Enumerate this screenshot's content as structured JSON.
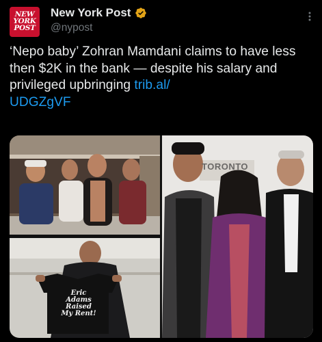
{
  "account": {
    "avatar_lines": [
      "NEW",
      "YORK",
      "POST"
    ],
    "display_name": "New York Post",
    "handle": "@nypost",
    "verified_color": "#e2a317"
  },
  "tweet": {
    "text": "‘Nepo baby’ Zohran Mamdani claims to have less then $2K in the bank — despite his salary and privileged upbringing ",
    "link_line1": "trib.al/",
    "link_line2": "UDGZgVF",
    "link_color": "#1d9bf0"
  },
  "media": {
    "photo_right_sign": "TORONTO",
    "photo_bottom_shirt_lines": [
      "Eric",
      "Adams",
      "Raised",
      "My Rent!"
    ]
  },
  "icons": {
    "verified": "verified-badge-icon",
    "more": "more-options-icon"
  }
}
